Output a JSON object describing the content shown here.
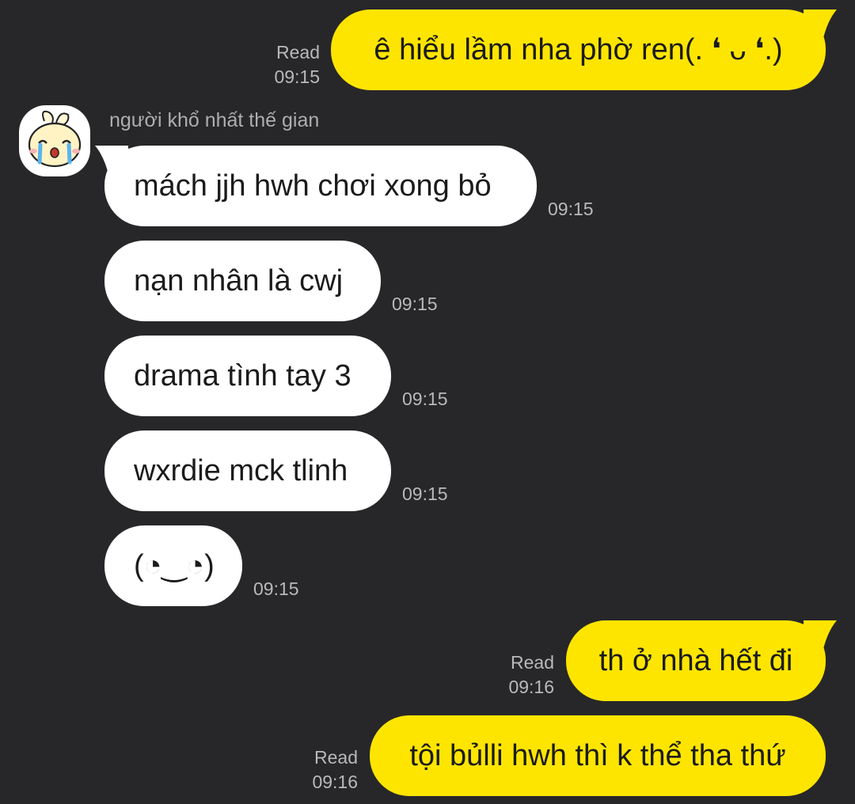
{
  "chat": {
    "sender_name": "người khổ nhất thế gian",
    "avatar_icon": "crying-bunny-icon",
    "colors": {
      "background": "#272729",
      "outgoing_bubble": "#fee500",
      "incoming_bubble": "#ffffff",
      "meta_text": "#b9b9bb"
    },
    "messages": [
      {
        "direction": "out",
        "text": "ê hiểu lầm nha phờ ren(. ❛ ᴗ ❛.)",
        "status": "Read",
        "time": "09:15"
      },
      {
        "direction": "in",
        "text": "mách jjh hwh chơi xong bỏ",
        "time": "09:15"
      },
      {
        "direction": "in",
        "text": "nạn nhân là cwj",
        "time": "09:15"
      },
      {
        "direction": "in",
        "text": "drama tình tay 3",
        "time": "09:15"
      },
      {
        "direction": "in",
        "text": "wxrdie mck tlinh",
        "time": "09:15"
      },
      {
        "direction": "in",
        "text": "(◔‿◔)",
        "time": "09:15"
      },
      {
        "direction": "out",
        "text": "th ở nhà hết đi",
        "status": "Read",
        "time": "09:16"
      },
      {
        "direction": "out",
        "text": "tội bủlli hwh thì k thể tha thứ",
        "status": "Read",
        "time": "09:16"
      }
    ]
  }
}
